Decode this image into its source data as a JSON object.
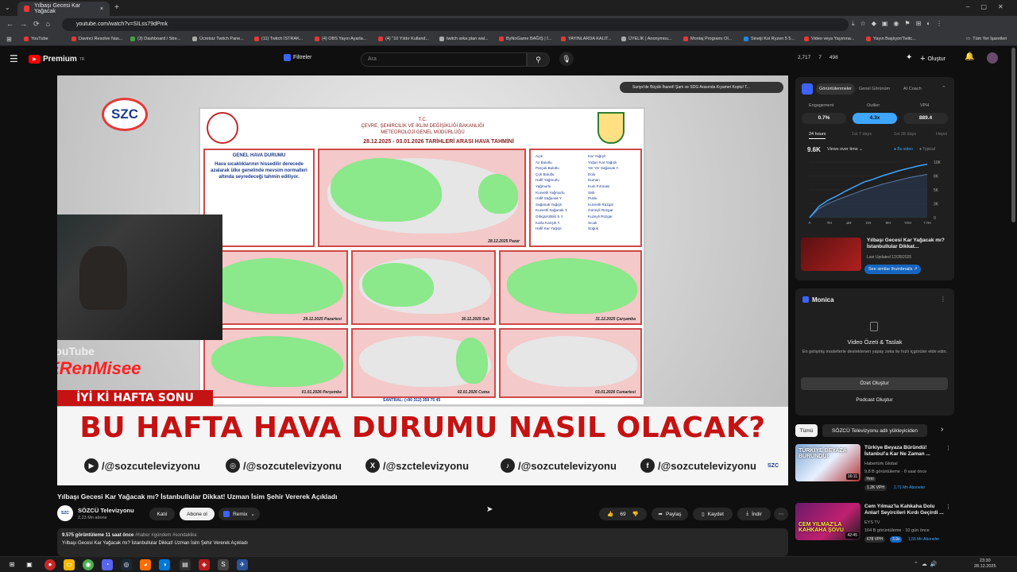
{
  "browser": {
    "tab_title": "Yılbaşı Gecesi Kar Yağacak",
    "url": "youtube.com/watch?v=SILss79dPmk",
    "bookmarks": [
      "YouTube",
      "Davinci Resolve Nas...",
      "(3) Dashboard / Stre...",
      "Ücretsiz Twitch Pane...",
      "(11) Twitch İSTRAK...",
      "(4) OBS Yayın Ayarla...",
      "(4) \"10 Yıldır Kulland...",
      "twitch arka plan wal...",
      "ByNoGame BAĞIŞ | İ...",
      "YAYINLARDA KALIT...",
      "ÜYELİK | Anonymou...",
      "Montaj Programı Ol...",
      "Sineiji Koi Ryzen 5 5...",
      "Video veya Yayınına...",
      "Yayın Başlıyor/Twitc..."
    ],
    "all_bookmarks": "Tüm Yer İşaretleri"
  },
  "yt": {
    "logo": "Premium",
    "logo_sup": "TR",
    "filters": "Filtreler",
    "search_placeholder": "Ara",
    "stats": [
      "2,717",
      "7",
      "498"
    ],
    "create": "Oluştur"
  },
  "video": {
    "top_notice": "Suriye'de Büyük İhanet! Şam ve SDG Arasında Kıyamet Koptu! T...",
    "channel_logo": "SZC",
    "map_ministry": "T.C.\nÇEVRE, ŞEHİRCİLİK VE İKLİM DEĞİŞİKLİĞİ BAKANLIĞI\nMETEOROLOJİ GENEL MÜDÜRLÜĞÜ",
    "map_dates": "28.12.2025 - 03.01.2026   TARİHLERİ ARASI HAVA TAHMİNİ",
    "map_general_title": "GENEL HAVA DURUMU",
    "map_general_text": "Hava sıcaklıklarının hissedilir derecede azalarak ülke genelinde mevsim normalleri altında seyredeceği tahmin ediliyor.",
    "legend_left": [
      "Açık",
      "Az Bulutlu",
      "Parçalı Bulutlu",
      "Çok Bulutlu",
      "Hafif Yağmurlu",
      "Yağmurlu",
      "Kuvvetli Yağmurlu",
      "Hafif Sağanak Y.",
      "Sağanak Yağışlı",
      "Kuvvetli Sağanak Y.",
      "Gökgürültülü S.Y.",
      "Karla Karışık Y.",
      "Hafif Kar Yağışlı"
    ],
    "legend_right": [
      "Kar Yağışlı",
      "Yoğun Kar Yağışlı",
      "Yer Yer Sağanak Y.",
      "Dolu",
      "Duman",
      "Kum Fırtınası",
      "Sisli",
      "Puslu",
      "Kuvvetli Rüzgar",
      "Güneyli Rüzgar",
      "Kuzeyli Rüzgar",
      "Sıcak",
      "Soğuk"
    ],
    "map_days": [
      "28.12.2025 Pazar",
      "29.12.2025 Pazartesi",
      "30.12.2025 Salı",
      "31.12.2025 Çarşamba",
      "01.01.2026 Perşembe",
      "02.01.2026 Cuma",
      "03.01.2026 Cumartesi"
    ],
    "map_footer": "SANTRAL: (+90 312) 359 75 45",
    "streamer_brand": "YouTube",
    "streamer_name": "ERenMisee",
    "tag": "İYİ Kİ HAFTA SONU",
    "headline": "BU HAFTA HAVA DURUMU NASIL OLACAK?",
    "socials": [
      "/@sozcutelevizyonu",
      "/@sozcutelevizyonu",
      "/@szctelevizyonu",
      "/@sozcutelevizyonu",
      "/@sozcutelevizyonu"
    ],
    "corner_logo": "SZC"
  },
  "meta": {
    "title": "Yılbaşı Gecesi Kar Yağacak mı? İstanbullular Dikkat! Uzman İsim Şehir Vererek Açıkladı",
    "channel": "SÖZCÜ Televizyonu",
    "subs": "2,23 Mn abone",
    "join": "Katıl",
    "subscribe": "Abone ol",
    "remix": "Remix",
    "likes": "69",
    "share": "Paylaş",
    "save": "Kaydet",
    "download": "İndir",
    "views": "9.575 görüntüleme  11 saat önce",
    "hashtags": "#haber #gündem #sondakika",
    "desc": "Yılbaşı Gecesi Kar Yağacak mı? İstanbullular Dikkat! Uzman İsim Şehir Vererek Açıkladı"
  },
  "analytics": {
    "tabs": [
      "Görüntülenmeler",
      "Genel Görünüm",
      "AI Coach"
    ],
    "labels": [
      "Engagement",
      "Outlier",
      "VPH"
    ],
    "values": [
      "0.7%",
      "4.3x",
      "889.4"
    ],
    "ranges": [
      "24 hours",
      "1st 7 days",
      "1st 28 days",
      "Hepsi"
    ],
    "total": "9.6K",
    "dropdown": "Views over time",
    "legend": [
      "Bu video",
      "Typical"
    ],
    "y_ticks": [
      "10K",
      "8K",
      "5K",
      "3K",
      "0"
    ],
    "x_ticks": [
      "0",
      "2H",
      "4H",
      "6H",
      "8H",
      "10H",
      "12H"
    ],
    "similar_title": "Yılbaşı Gecesi Kar Yağacak mı? İstanbullular Dikkat...",
    "similar_updated": "Last Updated 12/28/2025",
    "similar_btn": "See similar thumbnails"
  },
  "chart_data": {
    "type": "line",
    "x": [
      0,
      1,
      2,
      3,
      4,
      5,
      6,
      7,
      8,
      9,
      10,
      11,
      12,
      13
    ],
    "series": [
      {
        "values": [
          0,
          2000,
          3100,
          3900,
          4800,
          5600,
          6400,
          6900,
          7500,
          8000,
          8500,
          8900,
          9300,
          9600
        ]
      },
      {
        "values": [
          0,
          1600,
          2500,
          3200,
          3800,
          4400,
          5000,
          5500,
          6000,
          6400,
          6800,
          7200,
          7500,
          7800
        ]
      }
    ],
    "ylim": [
      0,
      10000
    ]
  },
  "monica": {
    "title": "Monica",
    "heading": "Video Özeti & Taslak",
    "text": "En gelişmiş modellerle desteklenen yapay zeka ile hızlı içgörüler elde edin.",
    "btn1": "Özet Oluştur",
    "btn2": "Podcast Oluştur"
  },
  "recs": {
    "chips": [
      "Tümü",
      "SÖZCÜ Televizyonu adlı yükleyiciden"
    ],
    "items": [
      {
        "title": "Türkiye Beyaza Büründü! İstanbul'a Kar Ne Zaman ...",
        "channel": "Habertürk Global",
        "meta": "9,8 B görüntüleme · 8 saat önce",
        "badge": "Yeni",
        "vph": "1.2K VPH",
        "abone": "2.71 Mn Aboneler",
        "duration": "16:11",
        "thumb_text": "TÜRKİYE BEYAZA BÜRÜNDÜ!"
      },
      {
        "title": "Cem Yılmaz'la Kahkaha Dolu Anlar! Seyircileri Kırdı Geçirdi ...",
        "channel": "EYS TV",
        "meta": "164 B görüntüleme · 10 gün önce",
        "badge": "",
        "vph": "678 VPH",
        "abone": "1,55 Mn Aboneler",
        "outlier": "3.9x",
        "duration": "42:45",
        "thumb_text": "CEM YILMAZ'LA KAHKAHA ŞOVU"
      }
    ]
  },
  "taskbar": {
    "time": "23:30",
    "date": "28.12.2025"
  }
}
